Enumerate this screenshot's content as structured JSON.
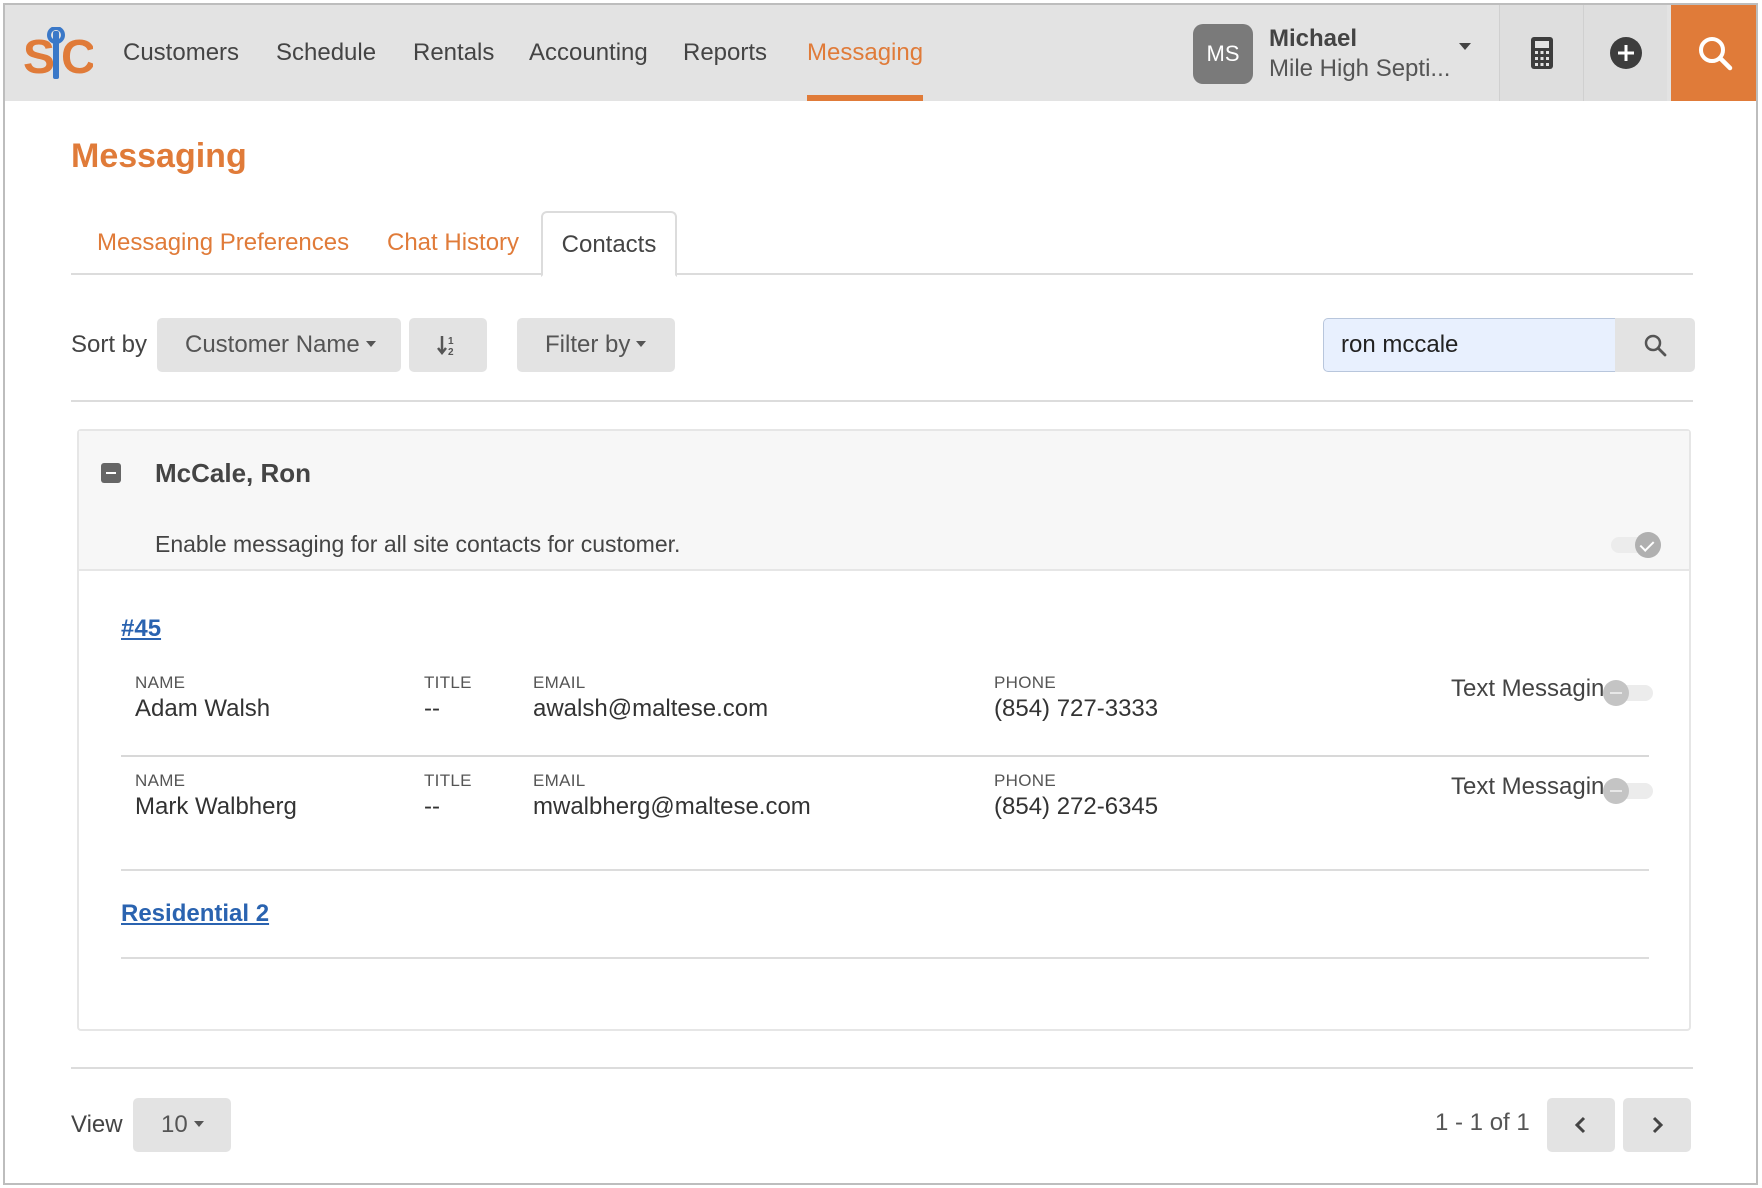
{
  "nav": {
    "logo_text": "SC",
    "items": [
      {
        "label": "Customers"
      },
      {
        "label": "Schedule"
      },
      {
        "label": "Rentals"
      },
      {
        "label": "Accounting"
      },
      {
        "label": "Reports"
      },
      {
        "label": "Messaging",
        "active": true
      }
    ],
    "user": {
      "initials": "MS",
      "name": "Michael",
      "company": "Mile High Septi..."
    },
    "icons": [
      "calculator-icon",
      "plus-circle-icon",
      "search-icon"
    ],
    "accent_color": "#e07b39"
  },
  "page": {
    "title": "Messaging"
  },
  "tabs": [
    {
      "label": "Messaging Preferences"
    },
    {
      "label": "Chat History"
    },
    {
      "label": "Contacts",
      "active": true
    }
  ],
  "toolbar": {
    "sort_label": "Sort by",
    "sort_value": "Customer Name",
    "filter_label": "Filter by",
    "search_value": "ron mccale"
  },
  "customer": {
    "name": "McCale, Ron",
    "enable_text": "Enable messaging for all site contacts for customer.",
    "enable_all": true,
    "sites": [
      {
        "label": "#45",
        "contacts": [
          {
            "name_label": "NAME",
            "name": "Adam Walsh",
            "title_label": "TITLE",
            "title": "--",
            "email_label": "EMAIL",
            "email": "awalsh@maltese.com",
            "phone_label": "PHONE",
            "phone": "(854) 727-3333",
            "tm_label": "Text Messaging",
            "tm_enabled": false
          },
          {
            "name_label": "NAME",
            "name": "Mark Walbherg",
            "title_label": "TITLE",
            "title": "--",
            "email_label": "EMAIL",
            "email": "mwalbherg@maltese.com",
            "phone_label": "PHONE",
            "phone": "(854) 272-6345",
            "tm_label": "Text Messaging",
            "tm_enabled": false
          }
        ]
      },
      {
        "label": "Residential 2",
        "contacts": []
      }
    ]
  },
  "footer": {
    "view_label": "View",
    "page_size": "10",
    "pager_text": "1 - 1 of 1"
  }
}
